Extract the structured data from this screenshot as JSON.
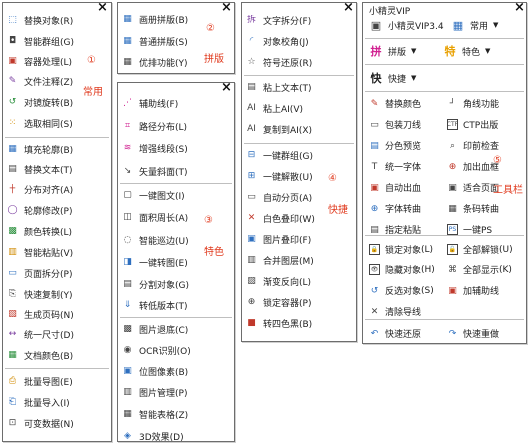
{
  "panel1": {
    "items": [
      {
        "icon": "⬚",
        "label": "替换对象(R)"
      },
      {
        "icon": "◘",
        "label": "智能群组(G)"
      },
      {
        "icon": "▣",
        "label": "容器处理(L)"
      },
      {
        "icon": "✎",
        "label": "文件注释(Z)"
      },
      {
        "icon": "↺",
        "label": "对镜旋转(B)"
      },
      {
        "icon": "⁙",
        "label": "选取相同(S)"
      },
      {
        "icon": "▦",
        "label": "填充轮廓(B)"
      },
      {
        "icon": "▤",
        "label": "替换文本(T)"
      },
      {
        "icon": "┼",
        "label": "分布对齐(A)"
      },
      {
        "icon": "◯",
        "label": "轮廓修改(P)"
      },
      {
        "icon": "▩",
        "label": "颜色转换(L)"
      },
      {
        "icon": "▥",
        "label": "智能粘贴(V)"
      },
      {
        "icon": "▭",
        "label": "页面拆分(P)"
      },
      {
        "icon": "⎘",
        "label": "快速复制(Y)"
      },
      {
        "icon": "▧",
        "label": "生成页码(N)"
      },
      {
        "icon": "↔",
        "label": "统一尺寸(D)"
      },
      {
        "icon": "▦",
        "label": "文档颜色(B)"
      },
      {
        "icon": "⎙",
        "label": "批量导图(E)"
      },
      {
        "icon": "⎗",
        "label": "批量导入(I)"
      },
      {
        "icon": "⊡",
        "label": "可变数据(N)"
      }
    ],
    "annotation_num": "①",
    "annotation_text": "常用"
  },
  "panel2": {
    "items": [
      {
        "icon": "▦",
        "label": "画册拼版(B)"
      },
      {
        "icon": "▦",
        "label": "普通拼版(S)"
      },
      {
        "icon": "▦",
        "label": "优排功能(Y)"
      }
    ],
    "annotation_num": "②",
    "annotation_text": "拼版"
  },
  "panel3": {
    "items": [
      {
        "icon": "⋰",
        "label": "辅助线(F)"
      },
      {
        "icon": "⌗",
        "label": "路径分布(L)"
      },
      {
        "icon": "≋",
        "label": "增强线段(S)"
      },
      {
        "icon": "↘",
        "label": "矢量斜面(T)"
      },
      {
        "icon": "▢",
        "label": "一键图文(I)"
      },
      {
        "icon": "◫",
        "label": "面积周长(A)"
      },
      {
        "icon": "◌",
        "label": "智能巡边(U)"
      },
      {
        "icon": "◨",
        "label": "一键转图(E)"
      },
      {
        "icon": "▤",
        "label": "分割对象(G)"
      },
      {
        "icon": "⇓",
        "label": "转低版本(T)"
      },
      {
        "icon": "▩",
        "label": "图片退底(C)"
      },
      {
        "icon": "◉",
        "label": "OCR识别(O)"
      },
      {
        "icon": "▣",
        "label": "位图像素(B)"
      },
      {
        "icon": "▥",
        "label": "图片管理(P)"
      },
      {
        "icon": "▦",
        "label": "智能表格(Z)"
      },
      {
        "icon": "◈",
        "label": "3D效果(D)"
      }
    ],
    "annotation_num": "③",
    "annotation_text": "特色"
  },
  "panel4": {
    "items": [
      {
        "icon": "拆",
        "label": "文字拆分(F)"
      },
      {
        "icon": "◜",
        "label": "对象校角(J)"
      },
      {
        "icon": "☆",
        "label": "符号还原(R)"
      },
      {
        "icon": "▤",
        "label": "粘上文本(T)"
      },
      {
        "icon": "AI",
        "label": "粘上AI(V)"
      },
      {
        "icon": "AI",
        "label": "复制到AI(X)"
      },
      {
        "icon": "⊟",
        "label": "一键群组(G)"
      },
      {
        "icon": "⊞",
        "label": "一键解散(U)"
      },
      {
        "icon": "▭",
        "label": "自动分页(A)"
      },
      {
        "icon": "✕",
        "label": "白色叠印(W)"
      },
      {
        "icon": "▣",
        "label": "图片叠印(F)"
      },
      {
        "icon": "▥",
        "label": "合并图层(M)"
      },
      {
        "icon": "▨",
        "label": "渐变反向(L)"
      },
      {
        "icon": "⊕",
        "label": "锁定容器(P)"
      },
      {
        "icon": "■",
        "label": "转四色黑(B)"
      }
    ],
    "annotation_num": "④",
    "annotation_text": "快捷"
  },
  "panel5": {
    "title": "小精灵VIP",
    "version_label": "小精灵VIP3.4",
    "dropdowns": [
      {
        "icon": "常",
        "label": "常用"
      },
      {
        "icon": "拼",
        "label": "拼版"
      },
      {
        "icon": "特",
        "label": "特色"
      },
      {
        "icon": "快",
        "label": "快捷"
      }
    ],
    "grid": [
      [
        "替换颜色",
        "角线功能"
      ],
      [
        "包装刀线",
        "CTP出版"
      ],
      [
        "分色预览",
        "印前检查"
      ],
      [
        "统一字体",
        "加出血框"
      ],
      [
        "自动出血",
        "适合页面"
      ],
      [
        "字体转曲",
        "条码转曲"
      ],
      [
        "指定粘贴",
        "一键PS"
      ],
      [
        "锁定对象",
        "全部解锁"
      ],
      [
        "隐藏对象",
        "全部显示"
      ],
      [
        "反选对象",
        "加辅助线"
      ],
      [
        "清除导线",
        ""
      ],
      [
        "快速还原",
        "快速重做"
      ]
    ],
    "grid_shortcuts": [
      [
        "",
        ""
      ],
      [
        "",
        ""
      ],
      [
        "",
        ""
      ],
      [
        "",
        ""
      ],
      [
        "",
        ""
      ],
      [
        "",
        ""
      ],
      [
        "",
        ""
      ],
      [
        "(L)",
        "(U)"
      ],
      [
        "(H)",
        "(K)"
      ],
      [
        "(S)",
        ""
      ],
      [
        "",
        ""
      ],
      [
        "",
        ""
      ]
    ],
    "annotation_num": "⑤",
    "annotation_text": "工具栏"
  },
  "colors": {
    "annotation": "#e03a1e",
    "border": "#6d6d6d",
    "accent": "#2e6fbf"
  }
}
